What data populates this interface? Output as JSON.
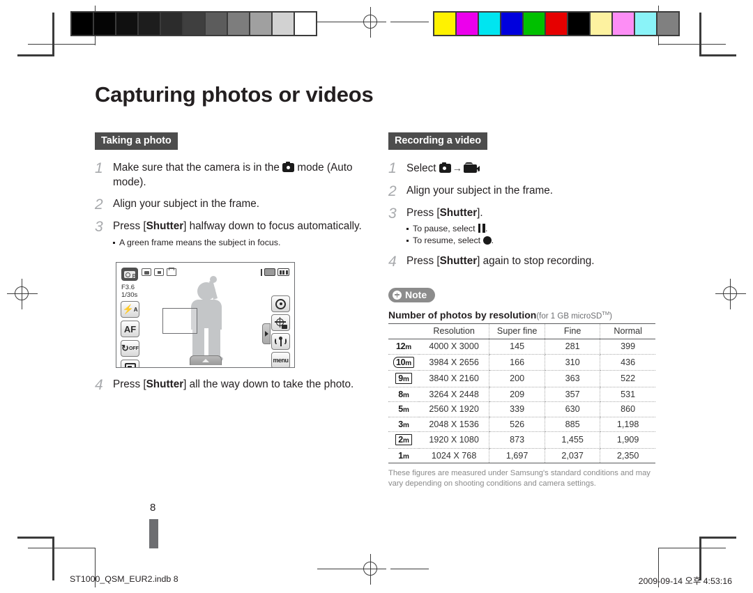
{
  "page": {
    "title": "Capturing photos or videos",
    "number": "8"
  },
  "left_column": {
    "section_label": "Taking a photo",
    "steps": [
      {
        "num": "1",
        "text_before": "Make sure that the camera is in the",
        "icon": "camera-icon",
        "text_after": "mode (Auto mode)."
      },
      {
        "num": "2",
        "text": "Align your subject in the frame."
      },
      {
        "num": "3",
        "text_bold_prefix": "Press [",
        "bold": "Shutter",
        "text_after": "] halfway down to focus automatically.",
        "bullets": [
          "A green frame means the subject in focus."
        ]
      },
      {
        "num": "4",
        "text_bold_prefix": "Press [",
        "bold": "Shutter",
        "text_after": "] all the way down to take the photo."
      }
    ]
  },
  "lcd_screen": {
    "mode_badge": "camera-program-mode-icon",
    "mode_letter": "P",
    "top_icons": [
      "face-detection-icon",
      "metering-icon",
      "frame-guide-icon"
    ],
    "aperture": "F3.6",
    "shutter_speed": "1/30s",
    "left_buttons": [
      {
        "name": "flash-button",
        "label": "F",
        "sup": "A"
      },
      {
        "name": "autofocus-button",
        "label": "AF"
      },
      {
        "name": "timer-button",
        "label": "C",
        "sub": "OFF"
      },
      {
        "name": "display-button",
        "label": "playback-icon"
      }
    ],
    "right_buttons": [
      {
        "name": "dial-button",
        "label": "dial-icon"
      },
      {
        "name": "focus-area-button",
        "label": "focus-icon"
      },
      {
        "name": "signal-button",
        "label": "signal-icon"
      },
      {
        "name": "menu-button",
        "label": "menu"
      }
    ]
  },
  "right_column": {
    "section_label": "Recording a video",
    "steps": [
      {
        "num": "1",
        "text_before": "Select",
        "icon_a": "camera-icon",
        "arrow": "→",
        "icon_b": "camcorder-icon",
        "text_after": "."
      },
      {
        "num": "2",
        "text": "Align your subject in the frame."
      },
      {
        "num": "3",
        "text_bold_prefix": "Press [",
        "bold": "Shutter",
        "text_after": "].",
        "bullets": [
          {
            "text_before": "To pause, select",
            "icon": "pause-icon",
            "text_after": "."
          },
          {
            "text_before": "To resume, select",
            "icon": "record-dot-icon",
            "text_after": "."
          }
        ]
      },
      {
        "num": "4",
        "text_bold_prefix": "Press [",
        "bold": "Shutter",
        "text_after": "] again to stop recording."
      }
    ],
    "note_badge": "Note",
    "table_caption": "Number of photos by resolution",
    "table_caption_sub_before": "(for 1 GB microSD",
    "table_caption_sup": "TM",
    "table_caption_sub_after": ")",
    "table_note": "These figures are measured under Samsung's standard conditions and may vary depending on shooting conditions and camera settings."
  },
  "resolution_table": {
    "headers": [
      "",
      "Resolution",
      "Super fine",
      "Fine",
      "Normal"
    ],
    "rows": [
      {
        "icon": "12",
        "icon_style": "plain",
        "resolution": "4000 X 3000",
        "super_fine": "145",
        "fine": "281",
        "normal": "399"
      },
      {
        "icon": "10",
        "icon_style": "wide",
        "resolution": "3984 X 2656",
        "super_fine": "166",
        "fine": "310",
        "normal": "436"
      },
      {
        "icon": "9",
        "icon_style": "boxed",
        "resolution": "3840 X 2160",
        "super_fine": "200",
        "fine": "363",
        "normal": "522"
      },
      {
        "icon": "8",
        "icon_style": "plain",
        "resolution": "3264 X 2448",
        "super_fine": "209",
        "fine": "357",
        "normal": "531"
      },
      {
        "icon": "5",
        "icon_style": "plain",
        "resolution": "2560 X 1920",
        "super_fine": "339",
        "fine": "630",
        "normal": "860"
      },
      {
        "icon": "3",
        "icon_style": "plain",
        "resolution": "2048 X 1536",
        "super_fine": "526",
        "fine": "885",
        "normal": "1,198"
      },
      {
        "icon": "2",
        "icon_style": "boxed",
        "resolution": "1920 X 1080",
        "super_fine": "873",
        "fine": "1,455",
        "normal": "1,909"
      },
      {
        "icon": "1",
        "icon_style": "plain",
        "resolution": "1024 X 768",
        "super_fine": "1,697",
        "fine": "2,037",
        "normal": "2,350"
      }
    ]
  },
  "footer": {
    "filename": "ST1000_QSM_EUR2.indb   8",
    "timestamp": "2009-09-14   오후 4:53:16"
  },
  "calibration": {
    "grayscale": [
      "#000000",
      "#050505",
      "#101010",
      "#1d1d1d",
      "#2c2c2c",
      "#3f3f3f",
      "#5c5c5c",
      "#7d7d7d",
      "#a0a0a0",
      "#d2d2d2",
      "#ffffff"
    ],
    "colors": [
      "#fff200",
      "#ec00ec",
      "#00e5f0",
      "#0000dd",
      "#00c000",
      "#e60000",
      "#000000",
      "#fdf2a0",
      "#fd8ef5",
      "#8af3f8",
      "#808080"
    ]
  }
}
